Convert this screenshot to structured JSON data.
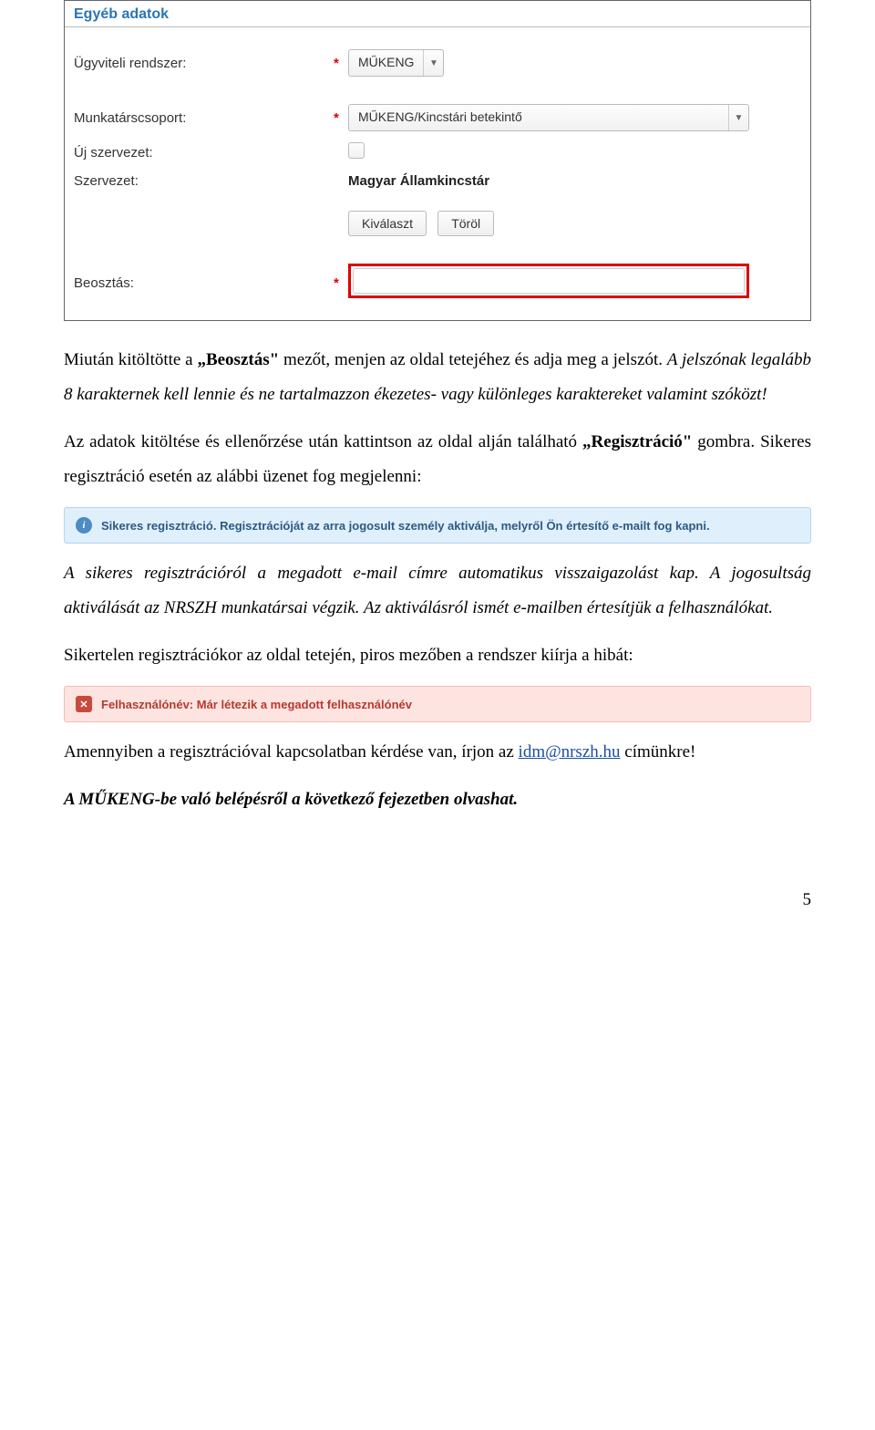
{
  "panel": {
    "title": "Egyéb adatok",
    "rows": {
      "system": {
        "label": "Ügyviteli rendszer:",
        "value": "MŰKENG"
      },
      "group": {
        "label": "Munkatárscsoport:",
        "value": "MŰKENG/Kincstári betekintő"
      },
      "neworg": {
        "label": "Új szervezet:"
      },
      "org": {
        "label": "Szervezet:",
        "value": "Magyar Államkincstár"
      },
      "buttons": {
        "select": "Kiválaszt",
        "delete": "Töröl"
      },
      "position": {
        "label": "Beosztás:"
      }
    }
  },
  "paragraphs": {
    "p1_a": "Miután kitöltötte a ",
    "p1_bold1": "„Beosztás\"",
    "p1_b": " mezőt, menjen az oldal tetejéhez és adja meg a jelszót. ",
    "p1_italic": "A jelszónak legalább 8 karakternek kell lennie és ne tartalmazzon ékezetes- vagy különleges karaktereket valamint szóközt!",
    "p2_a": "Az adatok kitöltése és ellenőrzése után kattintson az oldal alján található ",
    "p2_bold": "„Regisztráció\"",
    "p2_b": " gombra. Sikeres regisztráció esetén az alábbi üzenet fog megjelenni:",
    "p3": "A sikeres regisztrációról a megadott e-mail címre automatikus visszaigazolást kap. A jogosultság aktiválását az NRSZH munkatársai végzik. Az aktiválásról ismét e-mailben értesítjük a felhasználókat.",
    "p4": "Sikertelen regisztrációkor az oldal tetején, piros mezőben a rendszer kiírja a hibát:",
    "p5_a": "Amennyiben a regisztrációval kapcsolatban kérdése van, írjon az ",
    "p5_link": "idm@nrszh.hu",
    "p5_b": " címünkre!",
    "p6": "A MŰKENG-be való belépésről a következő fejezetben olvashat."
  },
  "alerts": {
    "info": "Sikeres regisztráció. Regisztrációját az arra jogosult személy aktiválja, melyről Ön értesítő e-mailt fog kapni.",
    "error": "Felhasználónév: Már létezik a megadott felhasználónév"
  },
  "pageNumber": "5",
  "star": "*"
}
